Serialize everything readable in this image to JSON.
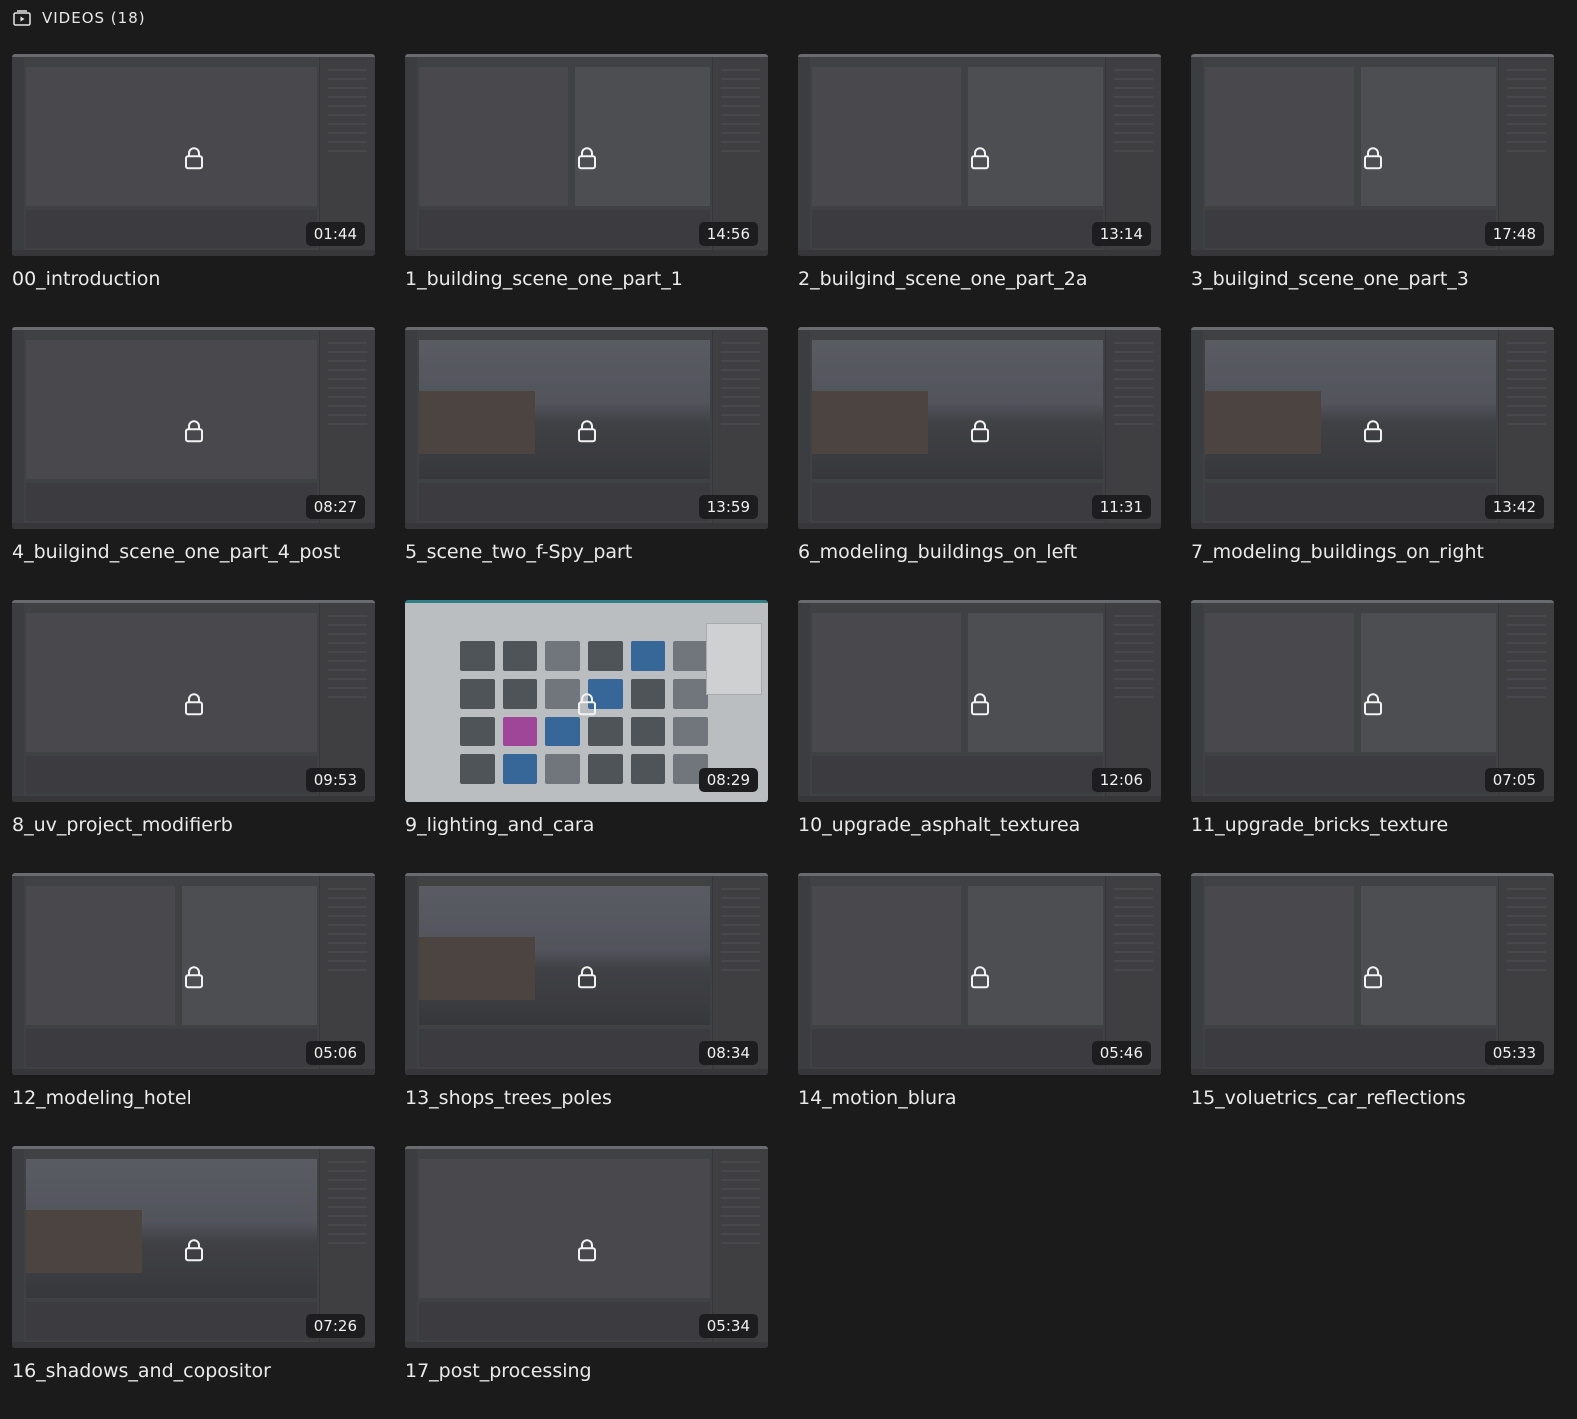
{
  "section": {
    "icon": "video-folder-icon",
    "label": "VIDEOS (18)"
  },
  "videos": [
    {
      "title": "00_introduction",
      "duration": "01:44",
      "locked": true
    },
    {
      "title": "1_building_scene_one_part_1",
      "duration": "14:56",
      "locked": true
    },
    {
      "title": "2_builgind_scene_one_part_2a",
      "duration": "13:14",
      "locked": true
    },
    {
      "title": "3_builgind_scene_one_part_3",
      "duration": "17:48",
      "locked": true
    },
    {
      "title": "4_builgind_scene_one_part_4_post",
      "duration": "08:27",
      "locked": true
    },
    {
      "title": "5_scene_two_f-Spy_part",
      "duration": "13:59",
      "locked": true
    },
    {
      "title": "6_modeling_buildings_on_left",
      "duration": "11:31",
      "locked": true
    },
    {
      "title": "7_modeling_buildings_on_right",
      "duration": "13:42",
      "locked": true
    },
    {
      "title": "8_uv_project_modifierb",
      "duration": "09:53",
      "locked": true
    },
    {
      "title": "9_lighting_and_cara",
      "duration": "08:29",
      "locked": true
    },
    {
      "title": "10_upgrade_asphalt_texturea",
      "duration": "12:06",
      "locked": true
    },
    {
      "title": "11_upgrade_bricks_texture",
      "duration": "07:05",
      "locked": true
    },
    {
      "title": "12_modeling_hotel",
      "duration": "05:06",
      "locked": true
    },
    {
      "title": "13_shops_trees_poles",
      "duration": "08:34",
      "locked": true
    },
    {
      "title": "14_motion_blura",
      "duration": "05:46",
      "locked": true
    },
    {
      "title": "15_voluetrics_car_reflections",
      "duration": "05:33",
      "locked": true
    },
    {
      "title": "16_shadows_and_copositor",
      "duration": "07:26",
      "locked": true
    },
    {
      "title": "17_post_processing",
      "duration": "05:34",
      "locked": true
    }
  ],
  "colors": {
    "background": "#1b1b1c",
    "duration_badge": "#1d1d1f",
    "text": "#eaeaea"
  }
}
